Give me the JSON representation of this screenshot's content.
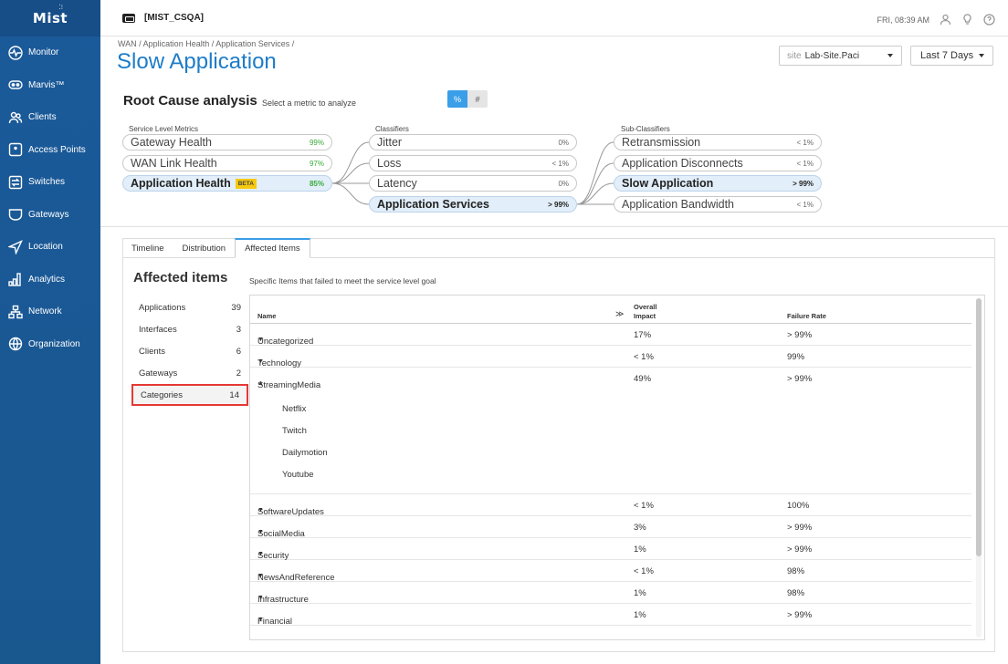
{
  "brand": {
    "logo": "Mist"
  },
  "sidebar": {
    "items": [
      {
        "label": "Monitor",
        "icon": "monitor-icon"
      },
      {
        "label": "Marvis™",
        "icon": "marvis-icon"
      },
      {
        "label": "Clients",
        "icon": "clients-icon"
      },
      {
        "label": "Access Points",
        "icon": "access-points-icon"
      },
      {
        "label": "Switches",
        "icon": "switches-icon"
      },
      {
        "label": "Gateways",
        "icon": "gateways-icon"
      },
      {
        "label": "Location",
        "icon": "location-icon"
      },
      {
        "label": "Analytics",
        "icon": "analytics-icon"
      },
      {
        "label": "Network",
        "icon": "network-icon"
      },
      {
        "label": "Organization",
        "icon": "organization-icon"
      }
    ]
  },
  "header": {
    "org": "[MIST_CSQA]",
    "datetime": "FRI, 08:39 AM"
  },
  "breadcrumb": "WAN / Application Health / Application Services /",
  "title": "Slow Application",
  "site_select": {
    "prefix": "site",
    "value": "Lab-Site.Paci"
  },
  "date_select": {
    "value": "Last 7 Days"
  },
  "rca": {
    "title": "Root Cause analysis",
    "subtitle": "Select a metric to analyze",
    "toggle": {
      "percent": "%",
      "count": "#"
    },
    "col_slm": "Service Level Metrics",
    "col_classifiers": "Classifiers",
    "col_sub": "Sub-Classifiers",
    "slm": [
      {
        "label": "Gateway Health",
        "pct": "99%"
      },
      {
        "label": "WAN Link Health",
        "pct": "97%"
      },
      {
        "label": "Application Health",
        "pct": "85%",
        "badge": "BETA"
      }
    ],
    "classifiers": [
      {
        "label": "Jitter",
        "pct": "0%"
      },
      {
        "label": "Loss",
        "pct": "< 1%"
      },
      {
        "label": "Latency",
        "pct": "0%"
      },
      {
        "label": "Application Services",
        "pct": "> 99%"
      }
    ],
    "sub_classifiers": [
      {
        "label": "Retransmission",
        "pct": "< 1%"
      },
      {
        "label": "Application Disconnects",
        "pct": "< 1%"
      },
      {
        "label": "Slow Application",
        "pct": "> 99%"
      },
      {
        "label": "Application Bandwidth",
        "pct": "< 1%"
      }
    ]
  },
  "tabs": [
    "Timeline",
    "Distribution",
    "Affected Items"
  ],
  "affected": {
    "title": "Affected items",
    "subtitle": "Specific Items that failed to meet the service level goal",
    "categories": [
      {
        "label": "Applications",
        "count": "39"
      },
      {
        "label": "Interfaces",
        "count": "3"
      },
      {
        "label": "Clients",
        "count": "6"
      },
      {
        "label": "Gateways",
        "count": "2"
      },
      {
        "label": "Categories",
        "count": "14"
      }
    ],
    "table": {
      "col_name": "Name",
      "col_impact_1": "Overall",
      "col_impact_2": "Impact",
      "col_failure": "Failure Rate",
      "rows": [
        {
          "name": "Uncategorized",
          "impact": "17%",
          "failure": "> 99%",
          "arrow": "▼"
        },
        {
          "name": "Technology",
          "impact": "< 1%",
          "failure": "99%",
          "arrow": "▼"
        },
        {
          "name": "StreamingMedia",
          "impact": "49%",
          "failure": "> 99%",
          "arrow": "▲"
        },
        {
          "name": "SoftwareUpdates",
          "impact": "< 1%",
          "failure": "100%",
          "arrow": "▼"
        },
        {
          "name": "SocialMedia",
          "impact": "3%",
          "failure": "> 99%",
          "arrow": "▼"
        },
        {
          "name": "Security",
          "impact": "1%",
          "failure": "> 99%",
          "arrow": "▼"
        },
        {
          "name": "NewsAndReference",
          "impact": "< 1%",
          "failure": "98%",
          "arrow": "▼"
        },
        {
          "name": "Infrastructure",
          "impact": "1%",
          "failure": "98%",
          "arrow": "▼"
        },
        {
          "name": "Financial",
          "impact": "1%",
          "failure": "> 99%",
          "arrow": "▼"
        }
      ],
      "sub_rows": [
        "Netflix",
        "Twitch",
        "Dailymotion",
        "Youtube"
      ]
    }
  }
}
